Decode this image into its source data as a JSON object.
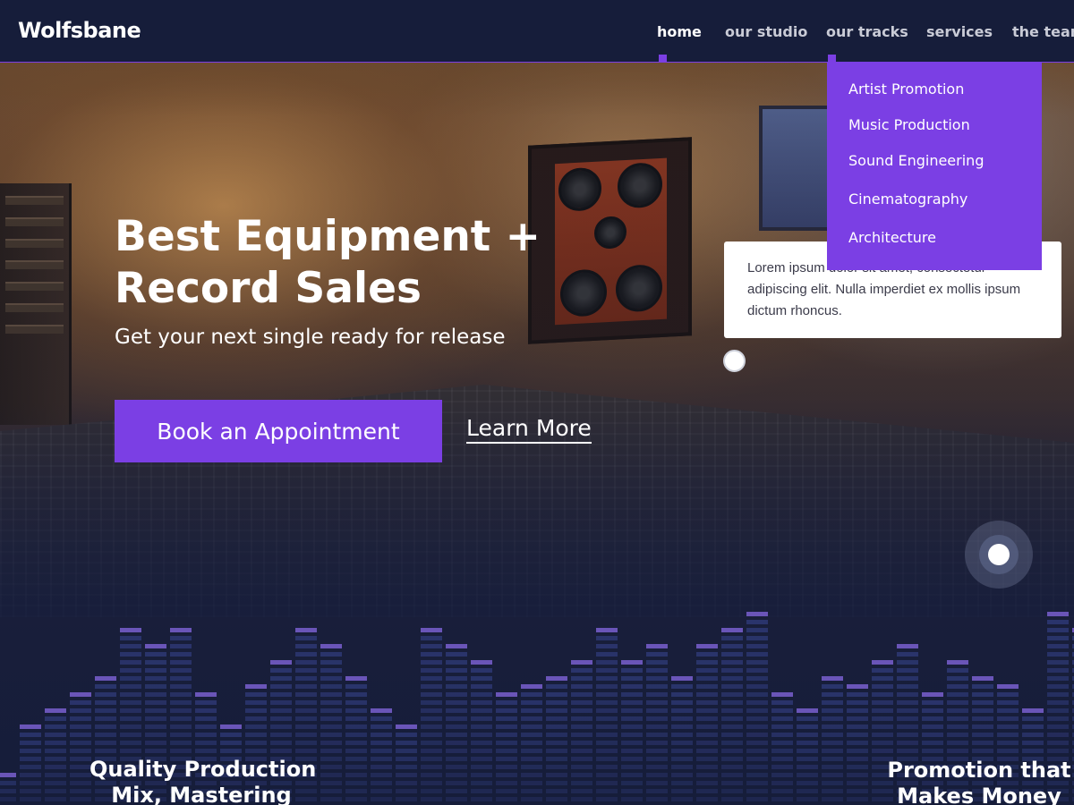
{
  "nav": {
    "brand": "Wolfsbane",
    "items": [
      {
        "label": "home",
        "active": true
      },
      {
        "label": "our studio",
        "active": false
      },
      {
        "label": "our tracks",
        "active": false
      },
      {
        "label": "services",
        "active": false
      },
      {
        "label": "the team",
        "active": false
      }
    ]
  },
  "dropdown": {
    "items": [
      "Artist Promotion",
      "Music Production",
      "Sound Engineering",
      "Cinematography",
      "Architecture"
    ]
  },
  "hero": {
    "headline_line1": "Best Equipment +",
    "headline_line2": "Record Sales",
    "subline": "Get your next single ready for release",
    "primary_button": "Book an Appointment",
    "secondary_link": "Learn More"
  },
  "card": {
    "text": "Lorem ipsum dolor sit amet, consectetur adipiscing elit. Nulla imperdiet ex mollis ipsum dictum rhoncus."
  },
  "features": {
    "left_line1": "Quality Production",
    "left_line2": "Mix, Mastering",
    "right_line1": "Promotion that",
    "right_line2": "Makes Money"
  },
  "colors": {
    "accent": "#7b3fe4",
    "nav_bg": "#161d3a",
    "text_light": "#ffffff",
    "nav_text": "#c9cbd6"
  },
  "icons": [
    "hotspot-dot-icon",
    "pulse-dot-icon",
    "equalizer-graphic"
  ]
}
